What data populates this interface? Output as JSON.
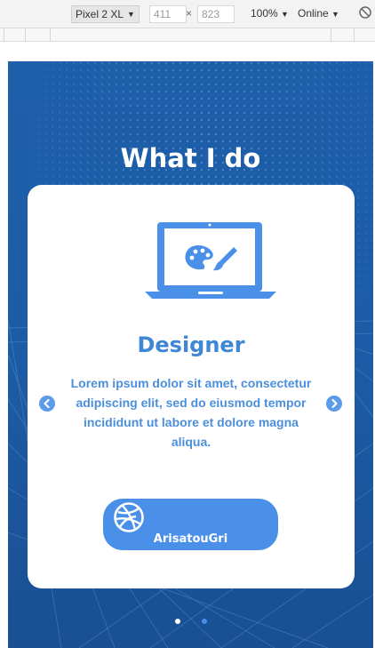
{
  "devtools": {
    "device": "Pixel 2 XL",
    "width": "411",
    "height": "823",
    "times": "×",
    "zoom": "100%",
    "throttle": "Online"
  },
  "page": {
    "title": "What I do",
    "card": {
      "role": "Designer",
      "description": "Lorem ipsum dolor sit amet, consectetur adipiscing elit, sed do eiusmod tempor incididunt ut labore et dolore magna aliqua.",
      "social": {
        "icon": "dribbble-icon",
        "handle": "ArisatouGri"
      },
      "illustration": "laptop-palette-brush-icon"
    },
    "carousel": {
      "prev_icon": "chevron-left-icon",
      "next_icon": "chevron-right-icon",
      "slides": 2,
      "active_slide": 2
    }
  },
  "colors": {
    "background": "#1e5faa",
    "card": "#ffffff",
    "accent": "#4a8fe8",
    "text_accent": "#3e86d6",
    "dot_inactive": "#ffffff",
    "dot_active": "#4a8fe8"
  }
}
